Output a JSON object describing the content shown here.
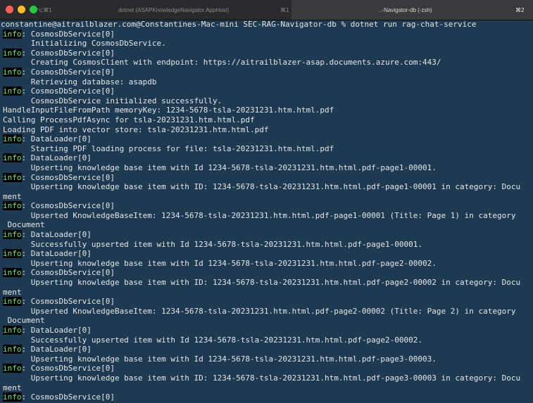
{
  "tabs": [
    {
      "shortcut_left": "⌥⌘1",
      "label": "dotnet (ASAPKnowledgeNavigator.AppHost)",
      "shortcut_right": "⌘1"
    },
    {
      "label": "..-Navigator-db (-zsh)",
      "shortcut_right": "⌘2"
    }
  ],
  "terminal": {
    "lines": [
      {
        "level": "",
        "text": "constantine@aitrailblazer.com@Constantines-Mac-mini SEC-RAG-Navigator-db % dotnet run rag-chat-service"
      },
      {
        "level": "info",
        "text": ": CosmosDbService[0]"
      },
      {
        "level": "",
        "text": "      Initializing CosmosDbService."
      },
      {
        "level": "info",
        "text": ": CosmosDbService[0]"
      },
      {
        "level": "",
        "text": "      Creating CosmosClient with endpoint: https://aitrailblazer-asap.documents.azure.com:443/"
      },
      {
        "level": "info",
        "text": ": CosmosDbService[0]"
      },
      {
        "level": "",
        "text": "      Retrieving database: asapdb"
      },
      {
        "level": "info",
        "text": ": CosmosDbService[0]"
      },
      {
        "level": "",
        "text": "      CosmosDbService initialized successfully."
      },
      {
        "level": "",
        "text": "HandleInputFileFromPath memoryKey: 1234-5678-tsla-20231231.htm.html.pdf"
      },
      {
        "level": "",
        "text": "Calling ProcessPdfAsync for tsla-20231231.htm.html.pdf"
      },
      {
        "level": "",
        "text": "Loading PDF into vector store: tsla-20231231.htm.html.pdf"
      },
      {
        "level": "info",
        "text": ": DataLoader[0]"
      },
      {
        "level": "",
        "text": "      Starting PDF loading process for file: tsla-20231231.htm.html.pdf"
      },
      {
        "level": "info",
        "text": ": DataLoader[0]"
      },
      {
        "level": "",
        "text": "      Upserting knowledge base item with Id 1234-5678-tsla-20231231.htm.html.pdf-page1-00001."
      },
      {
        "level": "info",
        "text": ": CosmosDbService[0]"
      },
      {
        "level": "",
        "text": "      Upserting knowledge base item with ID: 1234-5678-tsla-20231231.htm.html.pdf-page1-00001 in category: Docu"
      },
      {
        "level": "",
        "text": "ment"
      },
      {
        "level": "info",
        "text": ": CosmosDbService[0]"
      },
      {
        "level": "",
        "text": "      Upserted KnowledgeBaseItem: 1234-5678-tsla-20231231.htm.html.pdf-page1-00001 (Title: Page 1) in category"
      },
      {
        "level": "",
        "text": " Document"
      },
      {
        "level": "info",
        "text": ": DataLoader[0]"
      },
      {
        "level": "",
        "text": "      Successfully upserted item with Id 1234-5678-tsla-20231231.htm.html.pdf-page1-00001."
      },
      {
        "level": "info",
        "text": ": DataLoader[0]"
      },
      {
        "level": "",
        "text": "      Upserting knowledge base item with Id 1234-5678-tsla-20231231.htm.html.pdf-page2-00002."
      },
      {
        "level": "info",
        "text": ": CosmosDbService[0]"
      },
      {
        "level": "",
        "text": "      Upserting knowledge base item with ID: 1234-5678-tsla-20231231.htm.html.pdf-page2-00002 in category: Docu"
      },
      {
        "level": "",
        "text": "ment"
      },
      {
        "level": "info",
        "text": ": CosmosDbService[0]"
      },
      {
        "level": "",
        "text": "      Upserted KnowledgeBaseItem: 1234-5678-tsla-20231231.htm.html.pdf-page2-00002 (Title: Page 2) in category"
      },
      {
        "level": "",
        "text": " Document"
      },
      {
        "level": "info",
        "text": ": DataLoader[0]"
      },
      {
        "level": "",
        "text": "      Successfully upserted item with Id 1234-5678-tsla-20231231.htm.html.pdf-page2-00002."
      },
      {
        "level": "info",
        "text": ": DataLoader[0]"
      },
      {
        "level": "",
        "text": "      Upserting knowledge base item with Id 1234-5678-tsla-20231231.htm.html.pdf-page3-00003."
      },
      {
        "level": "info",
        "text": ": CosmosDbService[0]"
      },
      {
        "level": "",
        "text": "      Upserting knowledge base item with ID: 1234-5678-tsla-20231231.htm.html.pdf-page3-00003 in category: Docu"
      },
      {
        "level": "",
        "text": "ment"
      },
      {
        "level": "info",
        "text": ": CosmosDbService[0]"
      }
    ]
  },
  "colors": {
    "background": "#1e3a52",
    "info_fg": "#6ee76e",
    "info_bg": "#000000",
    "text": "#e6e6e6"
  }
}
